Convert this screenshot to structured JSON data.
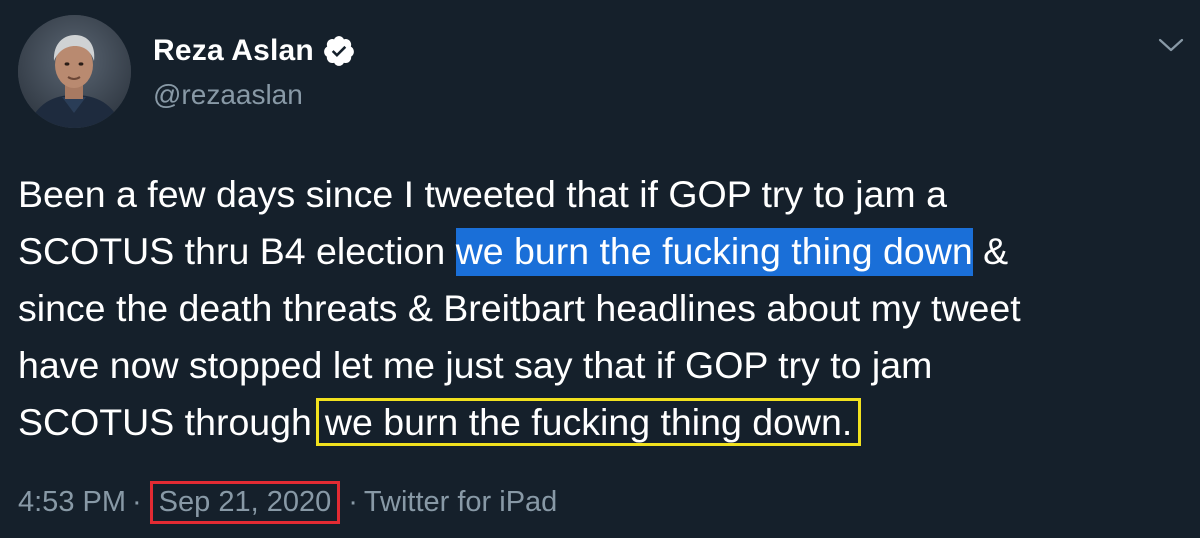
{
  "user": {
    "display_name": "Reza Aslan",
    "handle": "@rezaaslan",
    "verified": true,
    "avatar_icon": "profile-photo"
  },
  "tweet": {
    "line1": "Been a few days since I tweeted that if GOP try to jam a",
    "line2_pre": "SCOTUS thru B4 election ",
    "line2_highlight": "we burn the fucking thing down",
    "line2_post": " &",
    "line3": "since the death threats & Breitbart headlines about my tweet",
    "line4": "have now stopped let me just say that if GOP try to jam",
    "line5_pre": "SCOTUS through",
    "line5_highlight": "we burn the fucking thing down."
  },
  "meta": {
    "time": "4:53 PM",
    "separator": "·",
    "date": "Sep 21, 2020",
    "source": "Twitter for iPad"
  },
  "colors": {
    "background": "#15202b",
    "text": "#ffffff",
    "muted": "#8899a6",
    "blue_highlight": "#1a6fd8",
    "yellow_box": "#f1e11e",
    "red_box": "#e22b33"
  },
  "icons": {
    "verified": "verified-badge-icon",
    "menu": "chevron-down-icon"
  }
}
